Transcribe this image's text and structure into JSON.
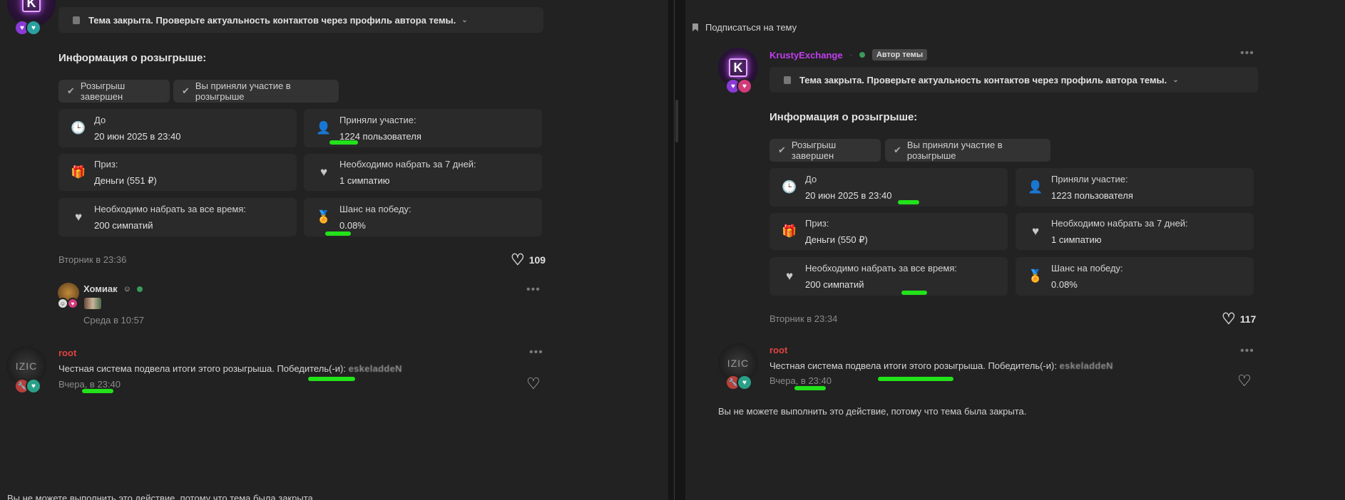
{
  "left": {
    "notice": "Тема закрыта. Проверьте актуальность контактов через профиль автора темы.",
    "giveaway_title": "Информация о розыгрыше:",
    "pills": [
      "Розыгрыш завершен",
      "Вы приняли участие в розыгрыше"
    ],
    "cards": [
      {
        "label": "До",
        "value": "20 июн 2025 в 23:40",
        "icon": "clock-icon"
      },
      {
        "label": "Приняли участие:",
        "value": "1224 пользователя",
        "icon": "user-plus-icon"
      },
      {
        "label": "Приз:",
        "value": "Деньги (551 ₽)",
        "icon": "gift-icon"
      },
      {
        "label": "Необходимо набрать за 7 дней:",
        "value": "1 симпатию",
        "icon": "heart-plus-icon"
      },
      {
        "label": "Необходимо набрать за все время:",
        "value": "200 симпатий",
        "icon": "heart-icon"
      },
      {
        "label": "Шанс на победу:",
        "value": "0.08%",
        "icon": "award-icon"
      }
    ],
    "post_time": "Вторник в 23:36",
    "likes": "109",
    "comment": {
      "user": "Хомиак",
      "time": "Среда в 10:57"
    },
    "root": {
      "user": "root",
      "text": "Честная система подвела итоги этого розыгрыша. Победитель(-и):",
      "winner": "eskeladdeN",
      "time": "Вчера, в 23:40"
    },
    "footer": "Вы не можете выполнить это действие, потому что тема была закрыта."
  },
  "right": {
    "subscribe": "Подписаться на тему",
    "author": "KrustyExchange",
    "author_tag": "Автор темы",
    "notice": "Тема закрыта. Проверьте актуальность контактов через профиль автора темы.",
    "giveaway_title": "Информация о розыгрыше:",
    "pills": [
      "Розыгрыш завершен",
      "Вы приняли участие в розыгрыше"
    ],
    "cards": [
      {
        "label": "До",
        "value": "20 июн 2025 в 23:40",
        "icon": "clock-icon"
      },
      {
        "label": "Приняли участие:",
        "value": "1223 пользователя",
        "icon": "user-plus-icon"
      },
      {
        "label": "Приз:",
        "value": "Деньги (550 ₽)",
        "icon": "gift-icon"
      },
      {
        "label": "Необходимо набрать за 7 дней:",
        "value": "1 симпатию",
        "icon": "heart-plus-icon"
      },
      {
        "label": "Необходимо набрать за все время:",
        "value": "200 симпатий",
        "icon": "heart-icon"
      },
      {
        "label": "Шанс на победу:",
        "value": "0.08%",
        "icon": "award-icon"
      }
    ],
    "post_time": "Вторник в 23:34",
    "likes": "117",
    "root": {
      "user": "root",
      "text": "Честная система подвела итоги этого розыгрыша. Победитель(-и):",
      "winner": "eskeladdeN",
      "time": "Вчера, в 23:40"
    },
    "footer": "Вы не можете выполнить это действие, потому что тема была закрыта."
  },
  "colors": {
    "highlight": "#22e21a",
    "root_name": "#e0443f",
    "author_name": "#c13ef0",
    "online": "#3a9a5a"
  }
}
